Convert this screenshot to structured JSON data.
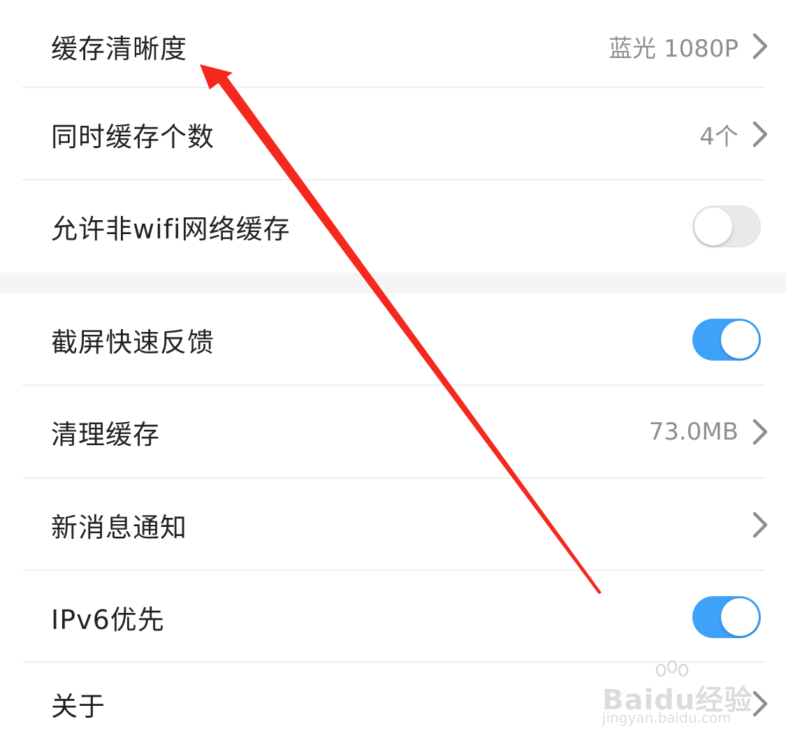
{
  "settings": {
    "cache_quality": {
      "label": "缓存清晰度",
      "value": "蓝光 1080P"
    },
    "concurrent_cache": {
      "label": "同时缓存个数",
      "value": "4个"
    },
    "non_wifi_cache": {
      "label": "允许非wifi网络缓存",
      "enabled": false
    },
    "screenshot_feedback": {
      "label": "截屏快速反馈",
      "enabled": true
    },
    "clear_cache": {
      "label": "清理缓存",
      "value": "73.0MB"
    },
    "notifications": {
      "label": "新消息通知"
    },
    "ipv6_priority": {
      "label": "IPv6优先",
      "enabled": true
    },
    "about": {
      "label": "关于"
    }
  },
  "watermark": {
    "brand": "Baidu经验",
    "url": "jingyan.baidu.com"
  },
  "colors": {
    "toggle_on": "#3ea2f8",
    "toggle_off": "#e9e9ea",
    "annotation_arrow": "#f5281e"
  },
  "icons": {
    "row_chevron": "chevron-right-icon",
    "annotation": "red-arrow-icon"
  }
}
